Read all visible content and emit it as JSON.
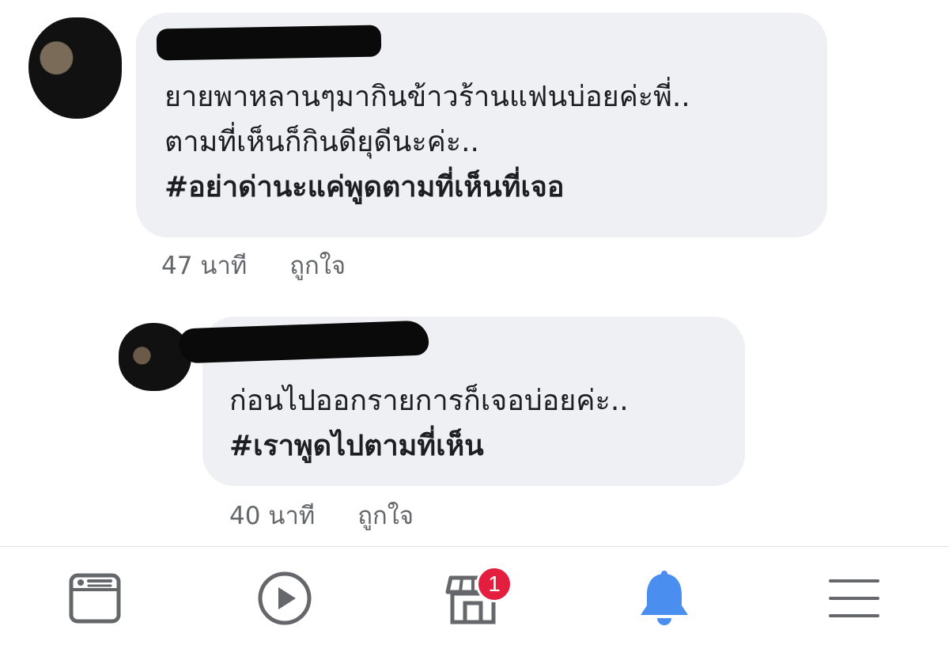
{
  "comments": [
    {
      "lines": [
        "ยายพาหลานๆมากินข้าวร้านแฟนบ่อยค่ะพี่..",
        "ตามที่เห็นก็กินดียุดีนะค่ะ.."
      ],
      "hashtag": "#อย่าด่านะแค่พูดตามที่เห็นที่เจอ",
      "time": "47 นาที",
      "like": "ถูกใจ"
    },
    {
      "lines": [
        "ก่อนไปออกรายการก็เจอบ่อยค่ะ.."
      ],
      "hashtag": "#เราพูดไปตามที่เห็น",
      "time": "40 นาที",
      "like": "ถูกใจ"
    }
  ],
  "nav": {
    "items": [
      "news-feed-icon",
      "watch-icon",
      "marketplace-icon",
      "notifications-icon",
      "menu-icon"
    ],
    "marketplace_badge": "1",
    "active_color": "#4a8ff0",
    "inactive_color": "#65676b",
    "badge_color": "#e41e3f"
  }
}
